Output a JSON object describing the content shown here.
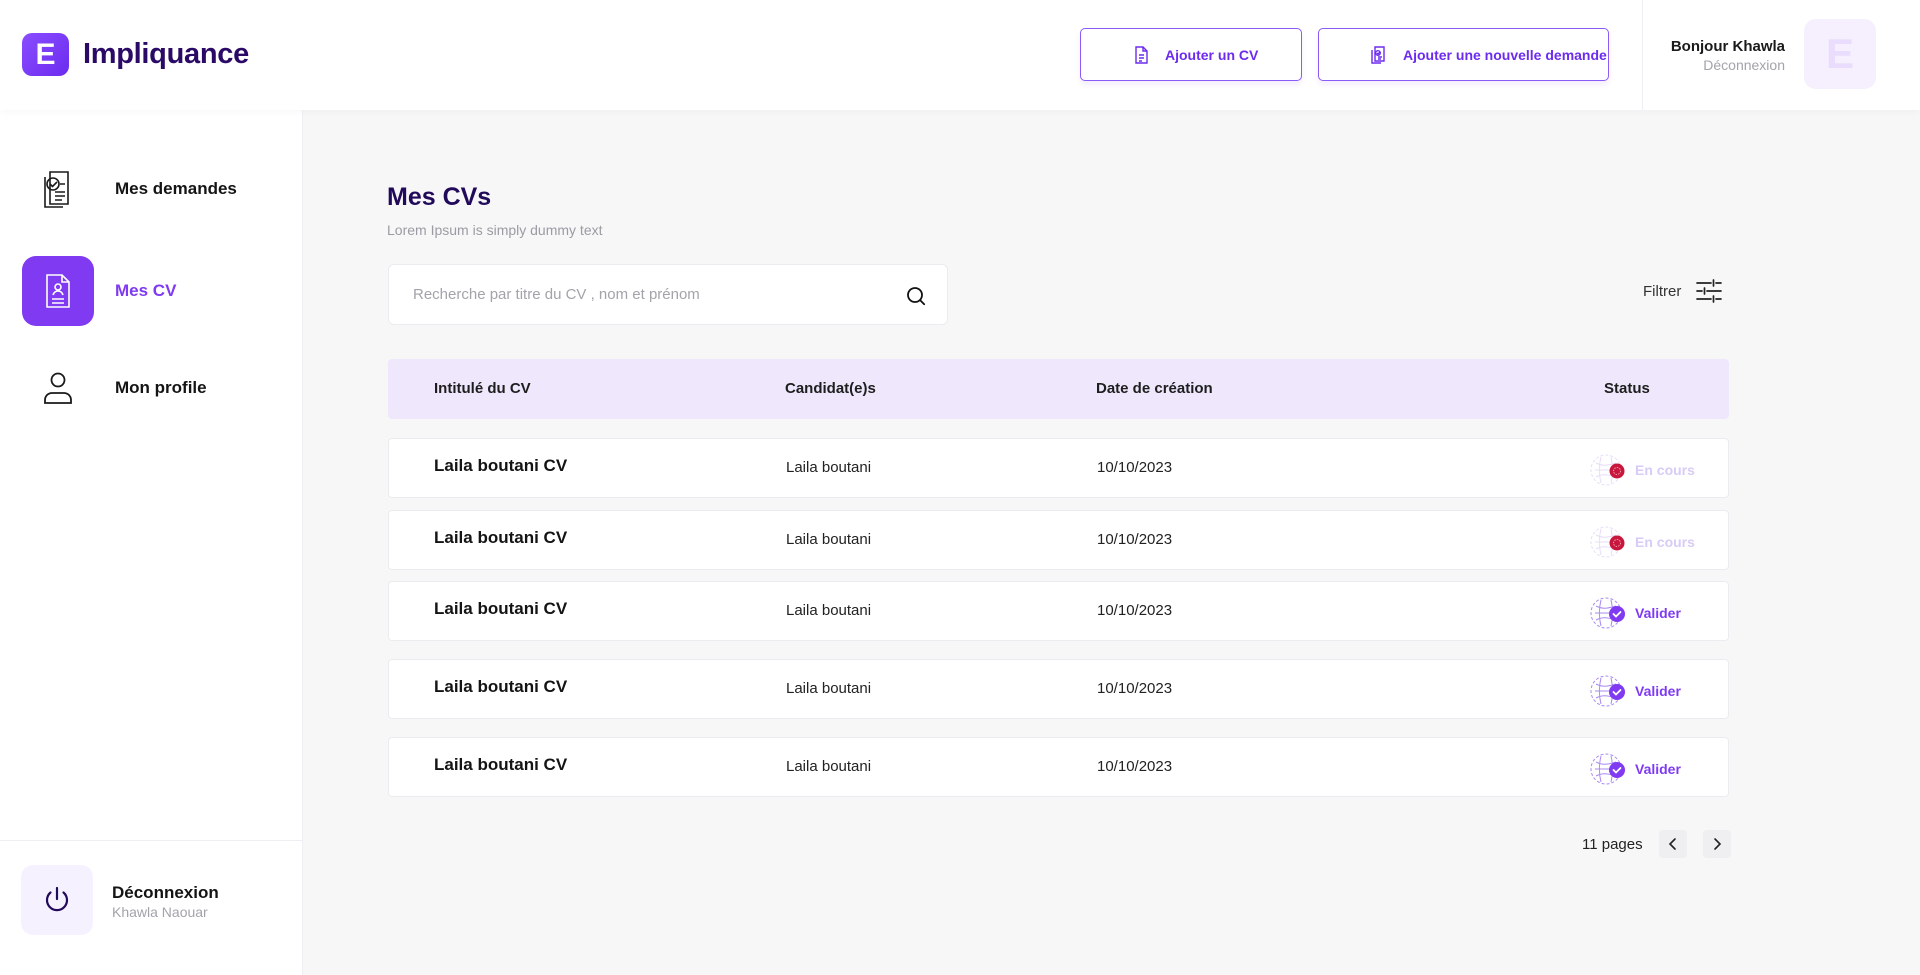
{
  "brand": {
    "logo_letter": "E",
    "name": "Impliquance"
  },
  "header": {
    "add_cv_label": "Ajouter un CV",
    "add_request_label": "Ajouter une nouvelle demande",
    "greeting": "Bonjour Khawla",
    "logout_label": "Déconnexion",
    "avatar_letter": "E"
  },
  "sidebar": {
    "items": [
      {
        "label": "Mes demandes",
        "icon": "document-check-icon",
        "active": false
      },
      {
        "label": "Mes CV",
        "icon": "cv-document-icon",
        "active": true
      },
      {
        "label": "Mon profile",
        "icon": "user-icon",
        "active": false
      }
    ],
    "logout": {
      "label": "Déconnexion",
      "user": "Khawla Naouar",
      "icon": "power-icon"
    }
  },
  "main": {
    "title": "Mes CVs",
    "subtitle": "Lorem Ipsum is simply dummy text",
    "search_placeholder": "Recherche par titre du CV , nom et prénom",
    "filter_label": "Filtrer",
    "columns": [
      "Intitulé du CV",
      "Candidat(e)s",
      "Date de création",
      "Status"
    ],
    "rows": [
      {
        "title": "Laila boutani CV",
        "candidate": "Laila boutani",
        "date": "10/10/2023",
        "status": "En cours",
        "state": "pending"
      },
      {
        "title": "Laila boutani CV",
        "candidate": "Laila boutani",
        "date": "10/10/2023",
        "status": "En cours",
        "state": "pending"
      },
      {
        "title": "Laila boutani CV",
        "candidate": "Laila boutani",
        "date": "10/10/2023",
        "status": "Valider",
        "state": "valid"
      },
      {
        "title": "Laila boutani CV",
        "candidate": "Laila boutani",
        "date": "10/10/2023",
        "status": "Valider",
        "state": "valid"
      },
      {
        "title": "Laila boutani CV",
        "candidate": "Laila boutani",
        "date": "10/10/2023",
        "status": "Valider",
        "state": "valid"
      }
    ],
    "pagination": {
      "label": "11 pages"
    }
  },
  "colors": {
    "accent": "#7f3af2",
    "brand_dark": "#220a5a",
    "pending_dot": "#c8163c",
    "header_row": "#efe8fd"
  }
}
